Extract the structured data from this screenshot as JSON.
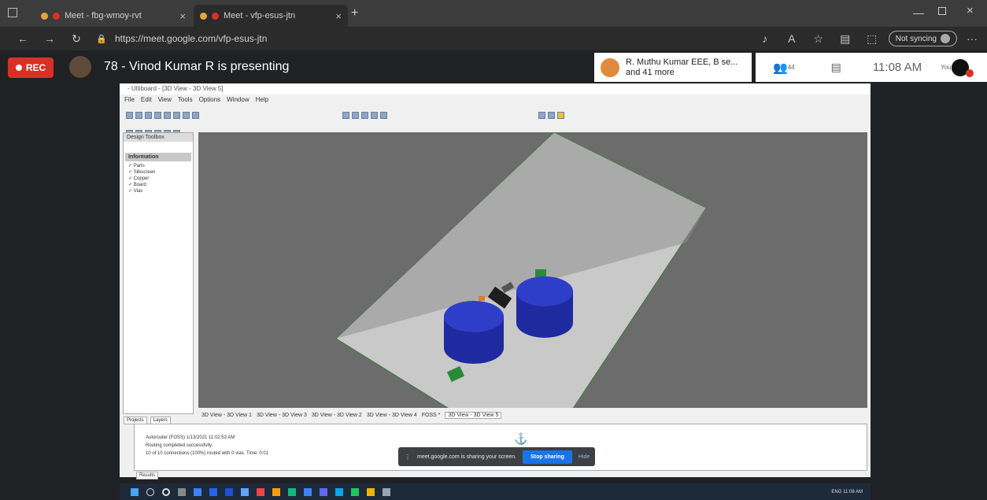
{
  "browser": {
    "tabs": [
      {
        "label": "Meet - fbg-wmoy-rvt",
        "active": false
      },
      {
        "label": "Meet - vfp-esus-jtn",
        "active": true
      }
    ],
    "new_tab": "+",
    "url": "https://meet.google.com/vfp-esus-jtn",
    "sync_label": "Not syncing",
    "more": "···"
  },
  "meet": {
    "rec_label": "REC",
    "presenting_text": "78 - Vinod Kumar R is presenting",
    "participants_line1": "R. Muthu Kumar EEE, B se...",
    "participants_line2": "and 41 more",
    "people_count": "44",
    "time": "11:08 AM",
    "you_label": "You"
  },
  "app": {
    "title": "- Ultiboard - [3D View - 3D View 5]",
    "menu": [
      "File",
      "Edit",
      "View",
      "Tools",
      "Options",
      "Window",
      "Help"
    ],
    "toolbox_title": "Design Toolbox",
    "toolbox_group": "Information",
    "toolbox_items": [
      "Parts",
      "Silkscreen",
      "Copper",
      "Board",
      "Vias"
    ],
    "bottom_tabs": [
      "Projects",
      "Layers"
    ],
    "doc_tabs": [
      "3D View - 3D View 1",
      "3D View - 3D View 3",
      "3D View - 3D View 2",
      "3D View - 3D View 4",
      "FOSS *",
      "3D View - 3D View 5"
    ],
    "output_lines": [
      "Autorouter (FOSS) 1/13/2021 11:02:53 AM",
      "Routing completed successfully.",
      "10 of 10 connections (100%) routed with 0 vias. Time: 0:01"
    ],
    "results_tab": "Results"
  },
  "share_bar": {
    "message": "meet.google.com is sharing your screen.",
    "stop_label": "Stop sharing",
    "hide_label": "Hide"
  },
  "taskbar": {
    "tray_text": "ENG  11:08 AM"
  },
  "colors": {
    "rec": "#d93025",
    "stop": "#1a73e8",
    "capacitor": "#2f3ec8"
  }
}
